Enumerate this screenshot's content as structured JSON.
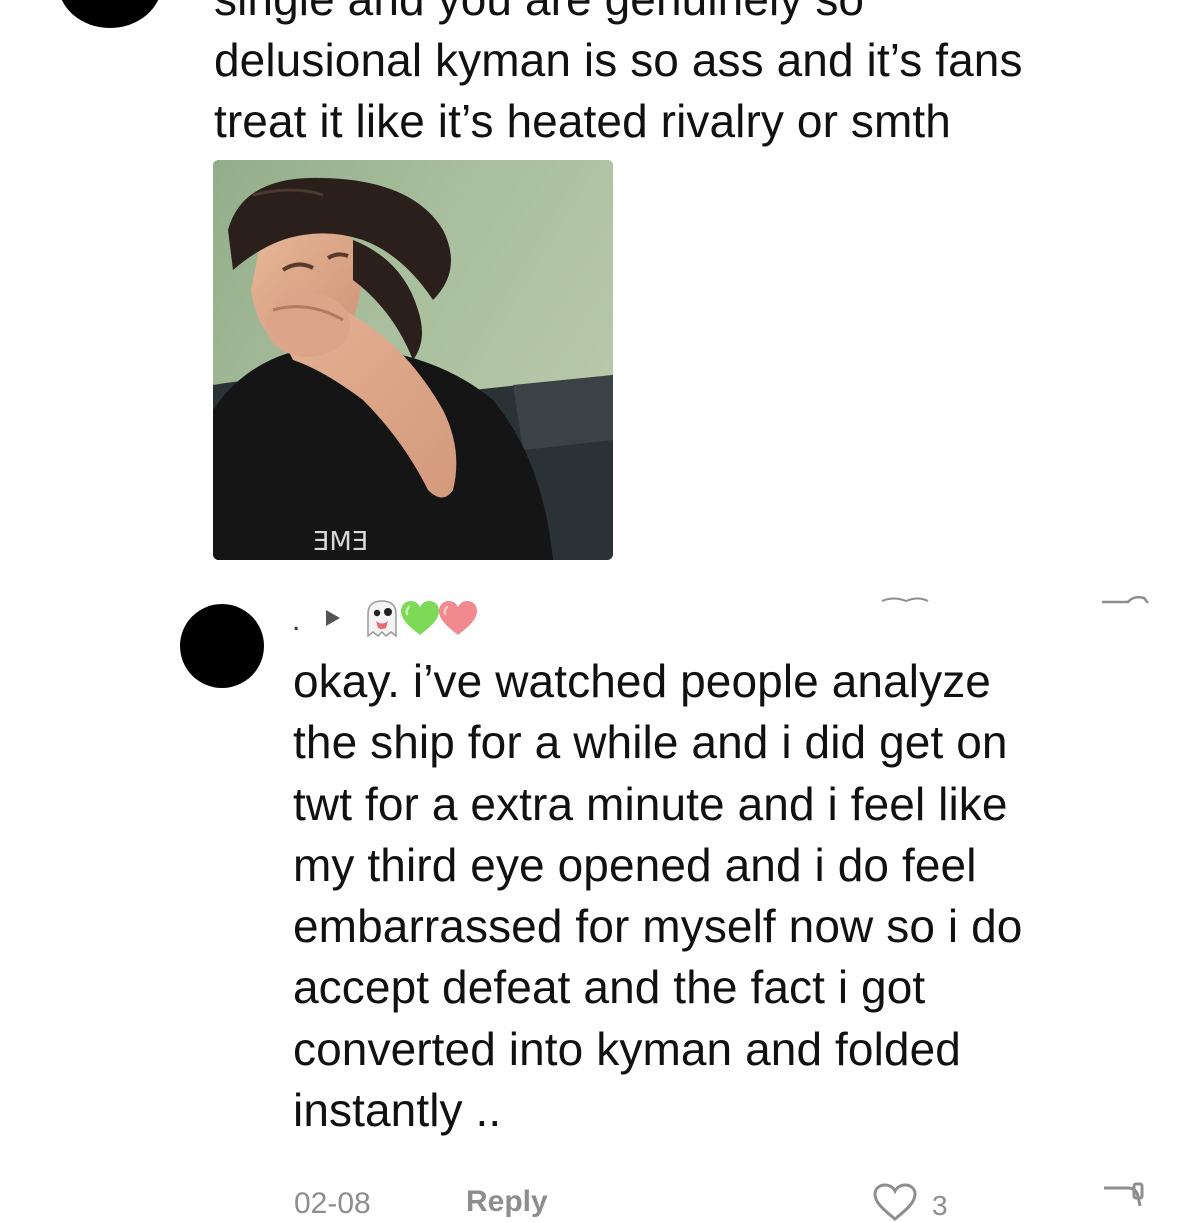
{
  "comment": {
    "text_lines": [
      "single and you are genuinely so",
      "delusional kyman is so ass and it’s fans",
      "treat it like it’s heated rivalry or smth"
    ],
    "image": {
      "icon": "gif-reaction-image",
      "shirt_text": "ƎMƎ"
    }
  },
  "reply": {
    "username": ".",
    "badges": [
      "ghost-emoji-icon",
      "green-heart-icon",
      "pink-heart-icon"
    ],
    "text_lines": [
      "okay. i’ve watched people analyze",
      "the ship for a while and i did get on",
      "twt for a extra minute and i feel like",
      "my third eye opened and i do feel",
      "embarrassed for myself now so i do",
      "accept defeat and the fact i got",
      "converted into kyman and folded",
      "instantly .."
    ],
    "footer": {
      "time": "02-08",
      "reply_label": "Reply",
      "like_count": "3"
    }
  },
  "colors": {
    "text": "#111111",
    "muted": "#8e8e8e",
    "green_heart": "#7ed957",
    "pink_heart": "#f08a8f"
  }
}
